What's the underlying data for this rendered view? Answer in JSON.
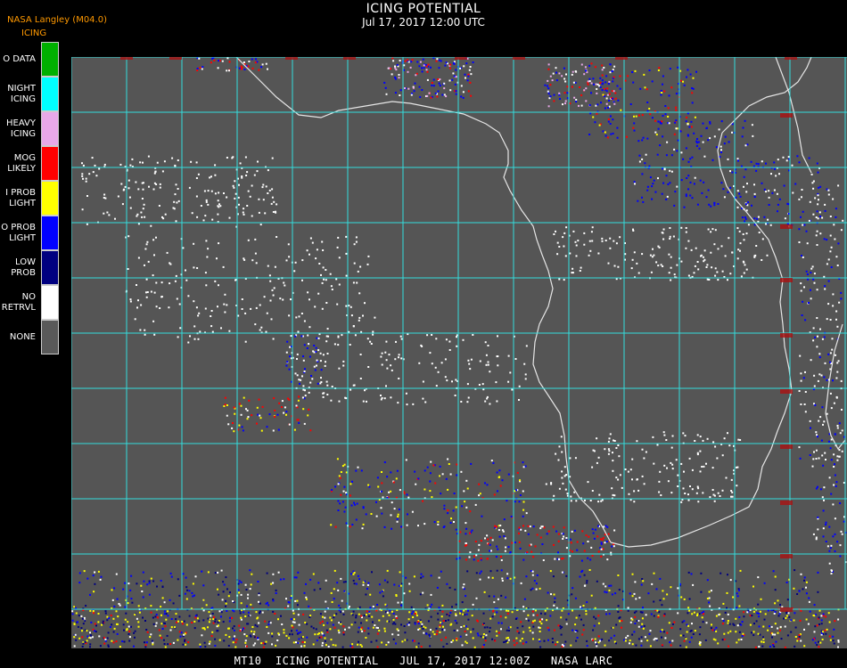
{
  "header": {
    "org": "NASA Langley (M04.0)",
    "product": "ICING",
    "title": "ICING POTENTIAL",
    "datetime": "Jul 17, 2017 12:00 UTC"
  },
  "legend": [
    {
      "label": "O DATA",
      "color": "#00b000"
    },
    {
      "label": "NIGHT\nICING",
      "color": "#00ffff"
    },
    {
      "label": "HEAVY\nICING",
      "color": "#e8a8e8"
    },
    {
      "label": "MOG\nLIKELY",
      "color": "#ff0000"
    },
    {
      "label": "I PROB\nLIGHT",
      "color": "#ffff00"
    },
    {
      "label": "O PROB\nLIGHT",
      "color": "#0000ff"
    },
    {
      "label": "LOW\nPROB",
      "color": "#000080"
    },
    {
      "label": "NO\nRETRVL",
      "color": "#ffffff"
    },
    {
      "label": "NONE",
      "color": "#595959"
    }
  ],
  "map": {
    "background_color": "#555555",
    "grid_color": "#33dddd",
    "coastline_color": "#e6e6e6"
  },
  "footer": "MT10  ICING POTENTIAL   JUL 17, 2017 12:00Z   NASA LARC"
}
